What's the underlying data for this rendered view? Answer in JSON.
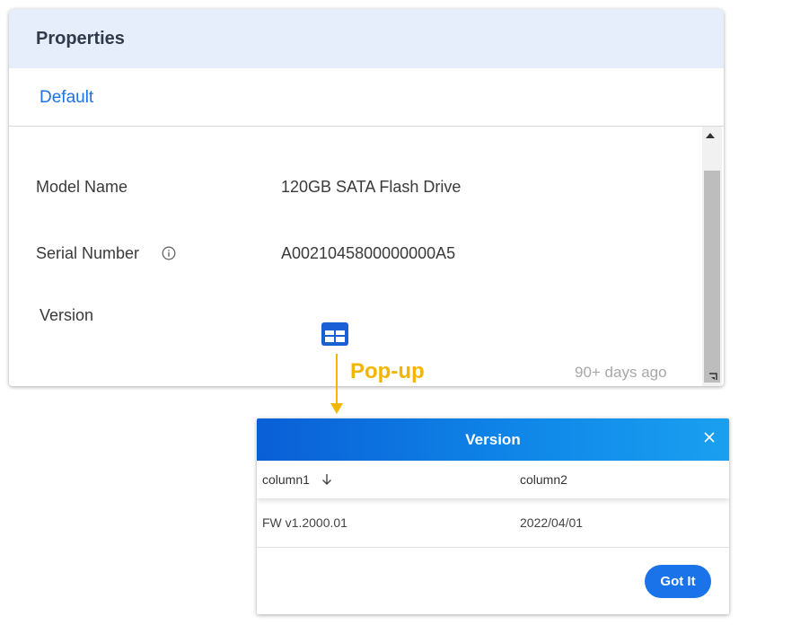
{
  "properties_panel": {
    "title": "Properties",
    "tab": "Default",
    "fields": [
      {
        "label": "Model Name",
        "value": "120GB SATA Flash Drive"
      },
      {
        "label": "Serial Number",
        "value": "A0021045800000000A5"
      },
      {
        "label": "Version",
        "value": ""
      }
    ],
    "updated": "90+ days ago"
  },
  "annotation": {
    "label": "Pop-up",
    "color": "#f5b400"
  },
  "dialog": {
    "title": "Version",
    "columns": [
      "column1",
      "column2"
    ],
    "rows": [
      [
        "FW v1.2000.01",
        "2022/04/01"
      ]
    ],
    "button": "Got It"
  },
  "colors": {
    "accent": "#1a73e8",
    "header_bg": "#e6eefb"
  }
}
